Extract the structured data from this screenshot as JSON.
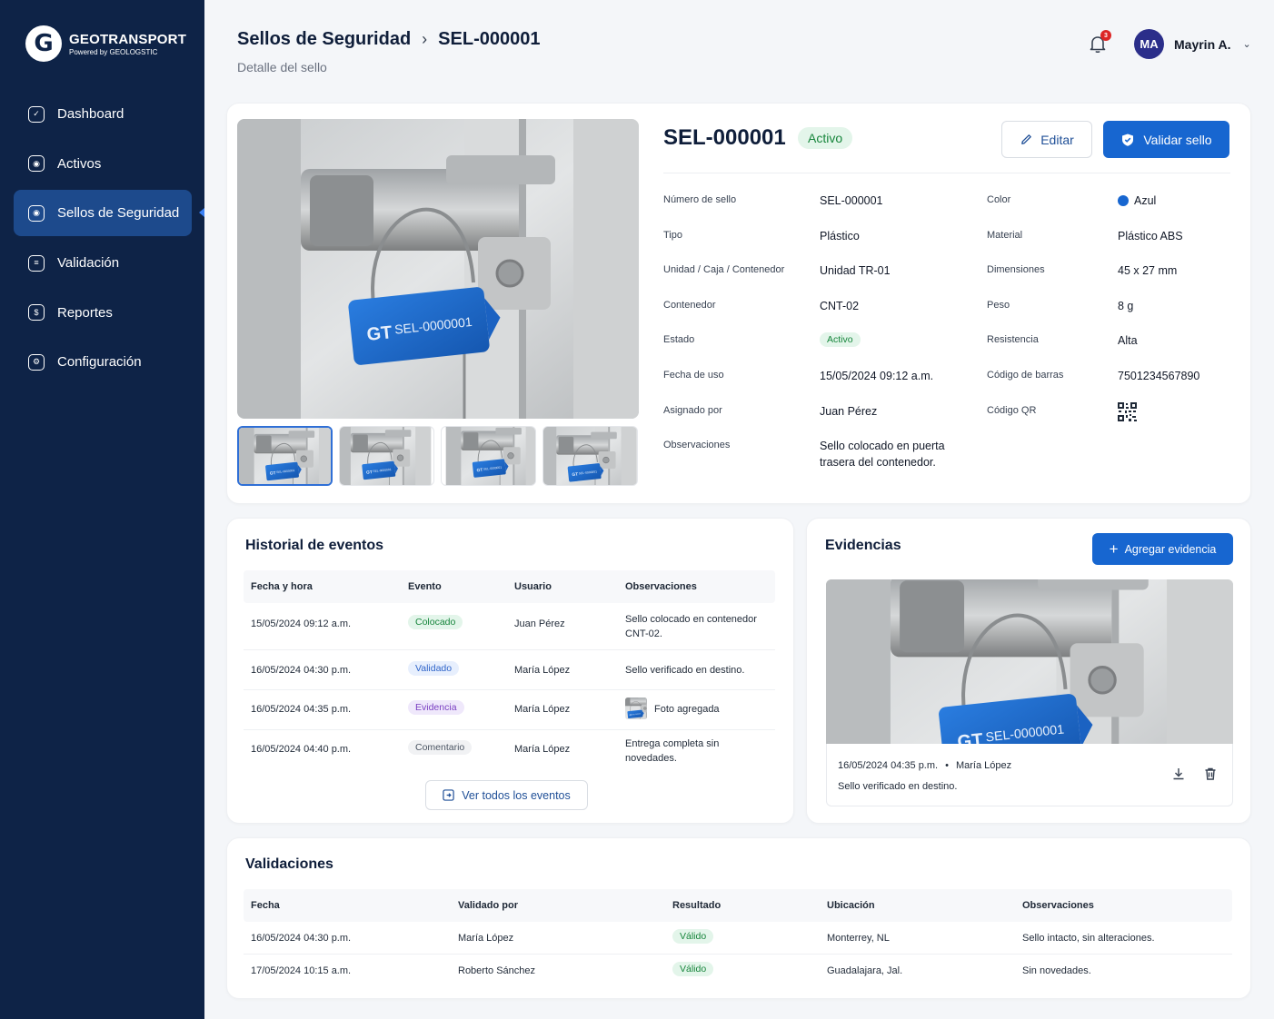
{
  "brand": {
    "name": "GEOTRANSPORT",
    "powered": "Powered by GEOLOGSTIC"
  },
  "sidebar": {
    "items": [
      {
        "label": "Dashboard"
      },
      {
        "label": "Activos"
      },
      {
        "label": "Sellos de Seguridad"
      },
      {
        "label": "Validación"
      },
      {
        "label": "Reportes"
      },
      {
        "label": "Configuración"
      }
    ]
  },
  "header": {
    "breadcrumb_parent": "Sellos de Seguridad",
    "breadcrumb_current": "SEL-000001",
    "subtitle": "Detalle del sello",
    "notifications_count": "3",
    "user_initials": "MA",
    "user_name": "Mayrin A."
  },
  "seal": {
    "id": "SEL-000001",
    "status": "Activo",
    "photo_tag": "SEL-000001",
    "photo_brand": "GT",
    "edit_label": "Editar",
    "validate_label": "Validar sello",
    "fields_left": [
      {
        "label": "Número de sello",
        "value": "SEL-000001"
      },
      {
        "label": "Tipo",
        "value": "Plástico"
      },
      {
        "label": "Unidad / Caja / Contenedor",
        "value": "Unidad TR-01"
      },
      {
        "label": "Contenedor",
        "value": "CNT-02"
      },
      {
        "label": "Estado",
        "value": "Activo"
      },
      {
        "label": "Fecha de uso",
        "value": "15/05/2024 09:12 a.m."
      },
      {
        "label": "Asignado por",
        "value": "Juan Pérez"
      },
      {
        "label": "Observaciones",
        "value_line1": "Sello colocado en puerta",
        "value_line2": "trasera del contenedor."
      }
    ],
    "fields_right": [
      {
        "label": "Color",
        "value": "Azul",
        "color": "#1766d0"
      },
      {
        "label": "Material",
        "value": "Plástico ABS"
      },
      {
        "label": "Dimensiones",
        "value": "45 x 27 mm"
      },
      {
        "label": "Peso",
        "value": "8 g"
      },
      {
        "label": "Resistencia",
        "value": "Alta"
      },
      {
        "label": "Código de barras",
        "value": "7501234567890"
      },
      {
        "label": "Código QR",
        "icon": "qr-code-icon"
      }
    ]
  },
  "history": {
    "title": "Historial de eventos",
    "headers": [
      "Fecha y hora",
      "Evento",
      "Usuario",
      "Observaciones"
    ],
    "rows": [
      {
        "date": "15/05/2024 09:12 a.m.",
        "event": "Colocado",
        "user": "Juan Pérez",
        "obs_line1": "Sello colocado en contenedor",
        "obs_line2": "CNT-02."
      },
      {
        "date": "16/05/2024 04:30 p.m.",
        "event": "Validado",
        "user": "María López",
        "obs_line1": "Sello verificado en destino.",
        "obs_line2": ""
      },
      {
        "date": "16/05/2024 04:35 p.m.",
        "event": "Evidencia",
        "user": "María López",
        "obs_line1": "Foto agregada",
        "obs_line2": ""
      },
      {
        "date": "16/05/2024 04:40 p.m.",
        "event": "Comentario",
        "user": "María López",
        "obs_line1": "Entrega completa sin",
        "obs_line2": "novedades."
      }
    ],
    "view_all": "Ver todos los eventos"
  },
  "evidence": {
    "title": "Evidencias",
    "add_label": "Agregar evidencia",
    "date": "16/05/2024 04:35 p.m.",
    "separator": "•",
    "user": "María López",
    "note": "Sello verificado en destino."
  },
  "validations": {
    "title": "Validaciones",
    "headers": [
      "Fecha",
      "Validado por",
      "Resultado",
      "Ubicación",
      "Observaciones"
    ],
    "rows": [
      {
        "date": "16/05/2024 04:30 p.m.",
        "by": "María López",
        "result": "Válido",
        "location": "Monterrey, NL",
        "obs": "Sello intacto, sin alteraciones."
      },
      {
        "date": "17/05/2024 10:15 a.m.",
        "by": "Roberto Sánchez",
        "result": "Válido",
        "location": "Guadalajara, Jal.",
        "obs": "Sin novedades."
      }
    ]
  },
  "colors": {
    "sidebar": "#0e2347",
    "accent": "#1766d0",
    "active_nav": "#1d4a8c",
    "success": "#16853b"
  }
}
